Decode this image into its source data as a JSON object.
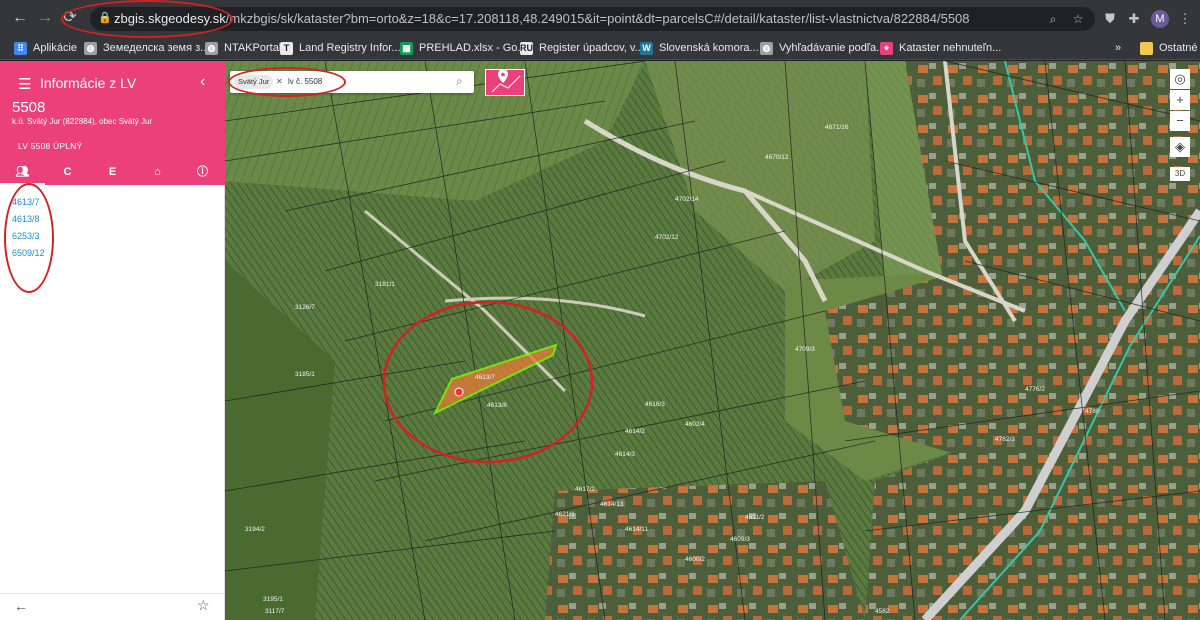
{
  "browser": {
    "url_host": "zbgis.skgeodesy.sk",
    "url_path": "/mkzbgis/sk/kataster?bm=orto&z=18&c=17.208118,48.249015&it=point&dt=parcelsC#/detail/kataster/list-vlastnictva/822884/5508",
    "avatar_letter": "M",
    "bookmarks": [
      {
        "label": "Aplikácie",
        "icon": "apps-grid-icon",
        "color": "#4285f4"
      },
      {
        "label": "Земеделска земя з...",
        "icon": "globe-icon",
        "color": "#9aa0a6"
      },
      {
        "label": "NTAKPortal",
        "icon": "globe-icon",
        "color": "#9aa0a6"
      },
      {
        "label": "Land Registry Infor...",
        "icon": "t-logo-icon",
        "color": "#e8eaed"
      },
      {
        "label": "PREHLAD.xlsx - Go...",
        "icon": "sheets-icon",
        "color": "#0f9d58"
      },
      {
        "label": "Register úpadcov, v...",
        "icon": "ru-logo-icon",
        "color": "#e8eaed"
      },
      {
        "label": "Slovenská komora...",
        "icon": "wordpress-icon",
        "color": "#21759b"
      },
      {
        "label": "Vyhľadávanie podľa...",
        "icon": "globe-icon",
        "color": "#9aa0a6"
      },
      {
        "label": "Kataster nehnuteľn...",
        "icon": "map-pin-icon",
        "color": "#ec407a"
      }
    ],
    "more_bookmarks": "»",
    "other_bookmarks": "Ostatné"
  },
  "panel": {
    "title": "Informácie z LV",
    "lv_number": "5508",
    "lv_subtitle": "k.ú. Svätý Jur (822884), obec Svätý Jur",
    "lv_button": "LV 5508 ÚPLNÝ",
    "tabs": [
      {
        "label": "people-icon",
        "icon": true
      },
      {
        "label": "C"
      },
      {
        "label": "E"
      },
      {
        "label": "home-icon",
        "icon": true
      },
      {
        "label": "info-icon",
        "icon": true
      }
    ],
    "tab_c": "C",
    "tab_e": "E",
    "parcels": [
      "4613/7",
      "4613/8",
      "6253/3",
      "6509/12"
    ]
  },
  "map": {
    "search_chip": "Svätý Jur",
    "search_query": "lv č. 5508",
    "view_3d": "3D",
    "annotation_color": "#d32222",
    "highlight_fill": "#e07b39",
    "highlight_stroke": "#7fff00",
    "parcel_labels": [
      {
        "text": "4613/7"
      },
      {
        "text": "4613/8"
      },
      {
        "text": "4614/2"
      },
      {
        "text": "4614/3"
      },
      {
        "text": "4616/3"
      },
      {
        "text": "4602/4"
      },
      {
        "text": "4702/14"
      },
      {
        "text": "4702/12"
      },
      {
        "text": "4670/12"
      },
      {
        "text": "4671/16"
      },
      {
        "text": "4709/3"
      },
      {
        "text": "4780"
      },
      {
        "text": "3126/7"
      },
      {
        "text": "3185/1"
      },
      {
        "text": "3194/2"
      },
      {
        "text": "3195/1"
      },
      {
        "text": "4621/1"
      },
      {
        "text": "4617/2"
      },
      {
        "text": "4614/13"
      },
      {
        "text": "4614/11"
      },
      {
        "text": "4611/2"
      },
      {
        "text": "4609/3"
      },
      {
        "text": "4600/2"
      },
      {
        "text": "4782/3"
      },
      {
        "text": "4776/2"
      },
      {
        "text": "3117/7"
      },
      {
        "text": "4582"
      },
      {
        "text": "3181/1"
      }
    ]
  }
}
